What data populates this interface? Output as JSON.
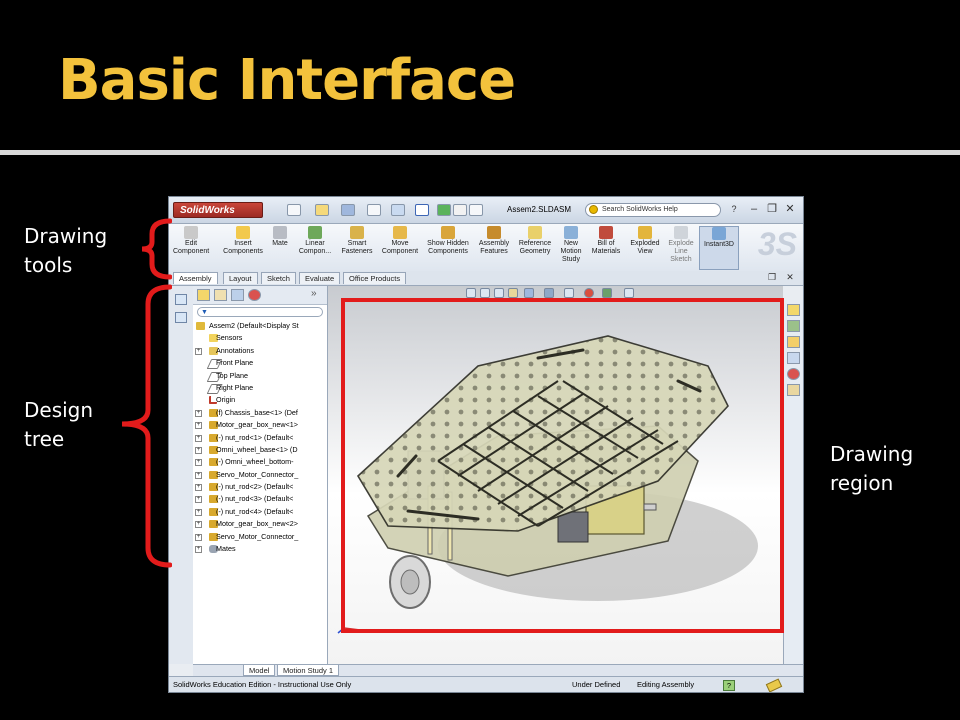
{
  "slide": {
    "title": "Basic Interface",
    "labels": {
      "drawing_tools": "Drawing tools",
      "design_tree": "Design tree",
      "drawing_region": "Drawing region"
    },
    "colors": {
      "title": "#F3C23C",
      "annotation": "#E21B1B",
      "background": "#000000"
    }
  },
  "window": {
    "app_logo": "SolidWorks",
    "document_title": "Assem2.SLDASM",
    "search_placeholder": "Search SolidWorks Help",
    "controls": {
      "minimize": "–",
      "restore": "❐",
      "close": "✕"
    },
    "help_icon": "?"
  },
  "command_manager": {
    "buttons": [
      {
        "label": "Edit Component",
        "icon": "edit-component-icon"
      },
      {
        "label": "Insert Components",
        "icon": "insert-components-icon"
      },
      {
        "label": "Mate",
        "icon": "mate-icon"
      },
      {
        "label": "Linear Compon...",
        "icon": "linear-pattern-icon"
      },
      {
        "label": "Smart Fasteners",
        "icon": "smart-fasteners-icon"
      },
      {
        "label": "Move Component",
        "icon": "move-component-icon"
      },
      {
        "label": "Show Hidden Components",
        "icon": "show-hidden-icon"
      },
      {
        "label": "Assembly Features",
        "icon": "assembly-features-icon"
      },
      {
        "label": "Reference Geometry",
        "icon": "reference-geometry-icon"
      },
      {
        "label": "New Motion Study",
        "icon": "motion-study-icon"
      },
      {
        "label": "Bill of Materials",
        "icon": "bom-icon"
      },
      {
        "label": "Exploded View",
        "icon": "exploded-view-icon"
      },
      {
        "label": "Explode Line Sketch",
        "icon": "explode-line-icon"
      },
      {
        "label": "Instant3D",
        "icon": "instant3d-icon"
      }
    ],
    "tabs": [
      "Assembly",
      "Layout",
      "Sketch",
      "Evaluate",
      "Office Products"
    ],
    "active_tab": "Assembly"
  },
  "feature_tree": {
    "panel_toggle": "»",
    "items": [
      {
        "label": "Assem2  (Default<Display St",
        "level": 0
      },
      {
        "label": "Sensors",
        "level": 1
      },
      {
        "label": "Annotations",
        "level": 1
      },
      {
        "label": "Front Plane",
        "level": 1
      },
      {
        "label": "Top Plane",
        "level": 1
      },
      {
        "label": "Right Plane",
        "level": 1
      },
      {
        "label": "Origin",
        "level": 1
      },
      {
        "label": "(f) Chassis_base<1> (Def",
        "level": 1
      },
      {
        "label": "Motor_gear_box_new<1>",
        "level": 1
      },
      {
        "label": "(-) nut_rod<1> (Default<",
        "level": 1
      },
      {
        "label": "Omni_wheel_base<1> (D",
        "level": 1
      },
      {
        "label": "(-) Omni_wheel_bottom-",
        "level": 1
      },
      {
        "label": "Servo_Motor_Connector_",
        "level": 1
      },
      {
        "label": "(-) nut_rod<2> (Default<",
        "level": 1
      },
      {
        "label": "(-) nut_rod<3> (Default<",
        "level": 1
      },
      {
        "label": "(-) nut_rod<4> (Default<",
        "level": 1
      },
      {
        "label": "Motor_gear_box_new<2>",
        "level": 1
      },
      {
        "label": "Servo_Motor_Connector_",
        "level": 1
      },
      {
        "label": "Mates",
        "level": 1
      }
    ]
  },
  "bottom_tabs": [
    "Model",
    "Motion Study 1"
  ],
  "status_bar": {
    "edition": "SolidWorks Education Edition - Instructional Use Only",
    "state": "Under Defined",
    "mode": "Editing Assembly",
    "help": "?"
  }
}
